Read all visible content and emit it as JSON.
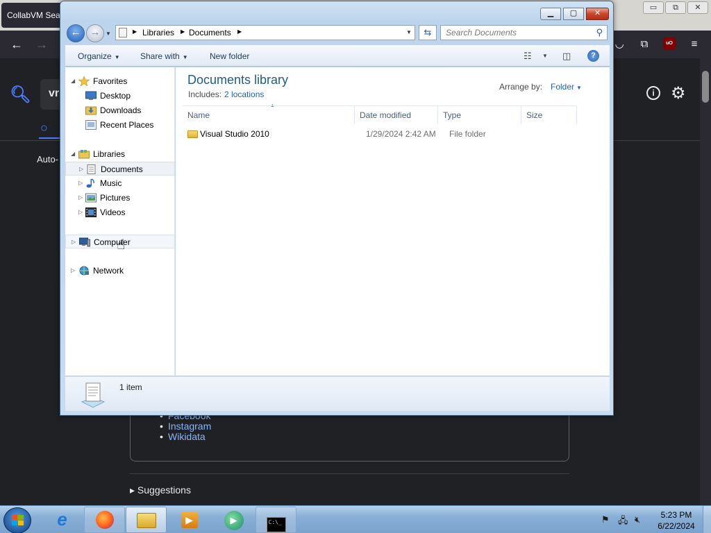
{
  "browser": {
    "tab_title": "CollabVM Sea",
    "winctl": {
      "min": "▭",
      "max": "⧉",
      "close": "✕"
    },
    "page": {
      "search_text": "vr",
      "auto_text": "Auto-",
      "links": [
        "Facebook",
        "Instagram",
        "Wikidata"
      ],
      "suggestions": "▸ Suggestions"
    }
  },
  "explorer": {
    "breadcrumbs": [
      "Libraries",
      "Documents"
    ],
    "search_placeholder": "Search Documents",
    "toolbar": {
      "organize": "Organize",
      "share_with": "Share with",
      "new_folder": "New folder"
    },
    "nav": {
      "favorites": "Favorites",
      "desktop": "Desktop",
      "downloads": "Downloads",
      "recent_places": "Recent Places",
      "libraries": "Libraries",
      "documents": "Documents",
      "music": "Music",
      "pictures": "Pictures",
      "videos": "Videos",
      "computer": "Computer",
      "network": "Network"
    },
    "library_title": "Documents library",
    "includes_label": "Includes:",
    "includes_link": "2 locations",
    "arrange_label": "Arrange by:",
    "arrange_value": "Folder",
    "columns": [
      "Name",
      "Date modified",
      "Type",
      "Size"
    ],
    "files": [
      {
        "name": "Visual Studio 2010",
        "date_modified": "1/29/2024 2:42 AM",
        "type": "File folder",
        "size": ""
      }
    ],
    "item_count": "1 item"
  },
  "taskbar": {
    "time": "5:23 PM",
    "date": "6/22/2024"
  },
  "colors": {
    "library_title": "#1e5b8a",
    "link": "#1f64b7",
    "close_button": "#c9452c"
  }
}
